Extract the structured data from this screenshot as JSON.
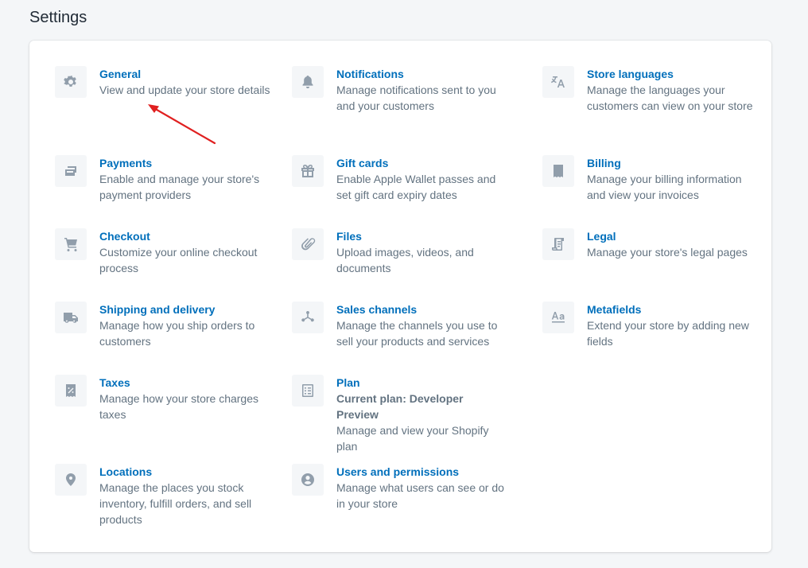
{
  "page": {
    "title": "Settings"
  },
  "colors": {
    "link": "#006fbb",
    "muted": "#637381",
    "icon": "#919eab",
    "annotation": "#e02020"
  },
  "items": [
    {
      "icon": "gear-icon",
      "title": "General",
      "desc": "View and update your store details"
    },
    {
      "icon": "bell-icon",
      "title": "Notifications",
      "desc": "Manage notifications sent to you and your customers"
    },
    {
      "icon": "translate-icon",
      "title": "Store languages",
      "desc": "Manage the languages your customers can view on your store"
    },
    {
      "icon": "credit-card-icon",
      "title": "Payments",
      "desc": "Enable and manage your store's payment providers"
    },
    {
      "icon": "gift-icon",
      "title": "Gift cards",
      "desc": "Enable Apple Wallet passes and set gift card expiry dates"
    },
    {
      "icon": "receipt-dollar-icon",
      "title": "Billing",
      "desc": "Manage your billing information and view your invoices"
    },
    {
      "icon": "cart-icon",
      "title": "Checkout",
      "desc": "Customize your online checkout process"
    },
    {
      "icon": "paperclip-icon",
      "title": "Files",
      "desc": "Upload images, videos, and documents"
    },
    {
      "icon": "legal-document-icon",
      "title": "Legal",
      "desc": "Manage your store's legal pages"
    },
    {
      "icon": "truck-icon",
      "title": "Shipping and delivery",
      "desc": "Manage how you ship orders to customers"
    },
    {
      "icon": "channels-icon",
      "title": "Sales channels",
      "desc": "Manage the channels you use to sell your products and services"
    },
    {
      "icon": "metafields-icon",
      "title": "Metafields",
      "desc": "Extend your store by adding new fields"
    },
    {
      "icon": "tax-receipt-icon",
      "title": "Taxes",
      "desc": "Manage how your store charges taxes"
    },
    {
      "icon": "plan-checklist-icon",
      "title": "Plan",
      "subtitle": "Current plan: Developer Preview",
      "desc": "Manage and view your Shopify plan"
    },
    {
      "icon": "location-pin-icon",
      "title": "Locations",
      "desc": "Manage the places you stock inventory, fulfill orders, and sell products"
    },
    {
      "icon": "user-circle-icon",
      "title": "Users and permissions",
      "desc": "Manage what users can see or do in your store"
    }
  ]
}
